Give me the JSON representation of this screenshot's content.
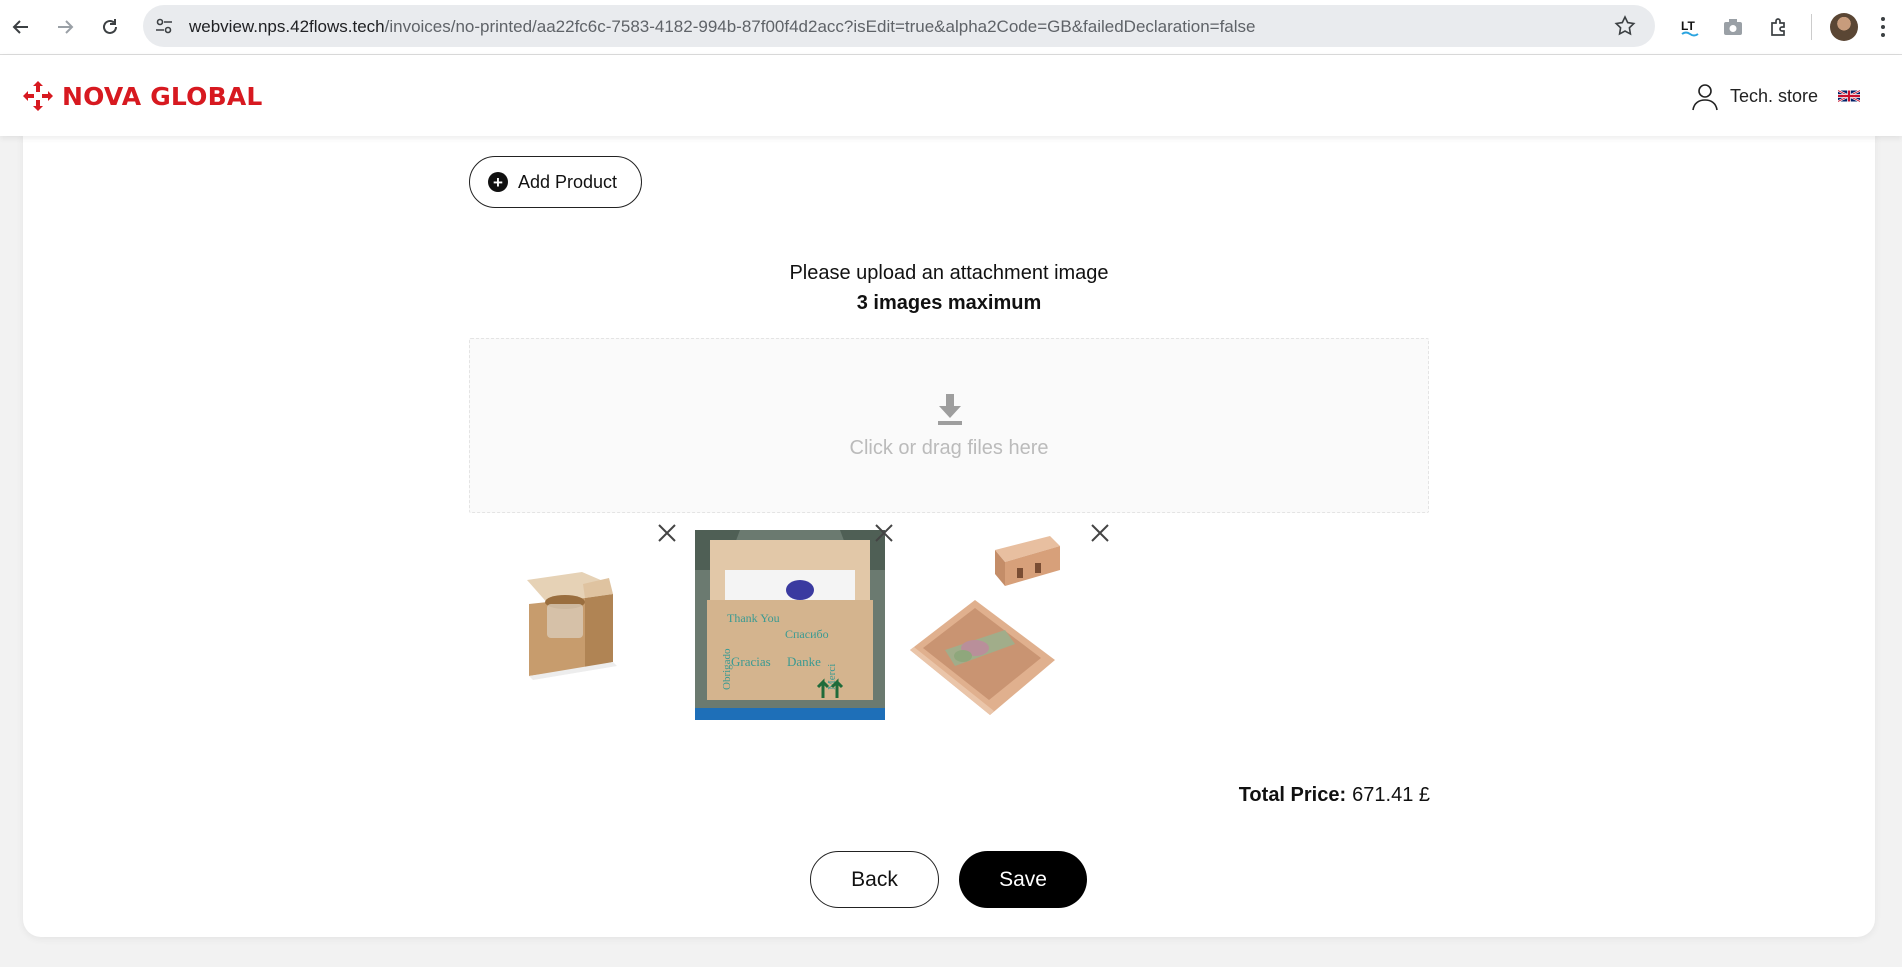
{
  "browser": {
    "url_host": "webview.nps.42flows.tech",
    "url_path": "/invoices/no-printed/aa22fc6c-7583-4182-994b-87f00f4d2acc?isEdit=true&alpha2Code=GB&failedDeclaration=false",
    "icons": [
      "back-arrow-icon",
      "forward-arrow-icon",
      "reload-icon",
      "site-settings-icon",
      "bookmark-star-icon",
      "languagetool-icon",
      "camera-icon",
      "extensions-puzzle-icon",
      "profile-avatar",
      "more-menu-icon"
    ]
  },
  "header": {
    "logo_text": "NOVA GLOBAL",
    "store_name": "Tech. store",
    "language": "GB",
    "brand_color": "#d71920"
  },
  "form": {
    "add_product_label": "Add Product",
    "upload_title": "Please upload an attachment image",
    "upload_limit": "3 images maximum",
    "dropzone_text": "Click or drag files here",
    "attachments": [
      {
        "name": "box-with-jar",
        "text": []
      },
      {
        "name": "thank-you-box",
        "text": [
          "Thank You",
          "Obrigado",
          "Спасибо",
          "Gracias",
          "Danke",
          "Merci"
        ]
      },
      {
        "name": "long-box-with-plant",
        "text": []
      }
    ],
    "total_label": "Total Price:",
    "total_value": "671.41 £",
    "back_label": "Back",
    "save_label": "Save"
  }
}
